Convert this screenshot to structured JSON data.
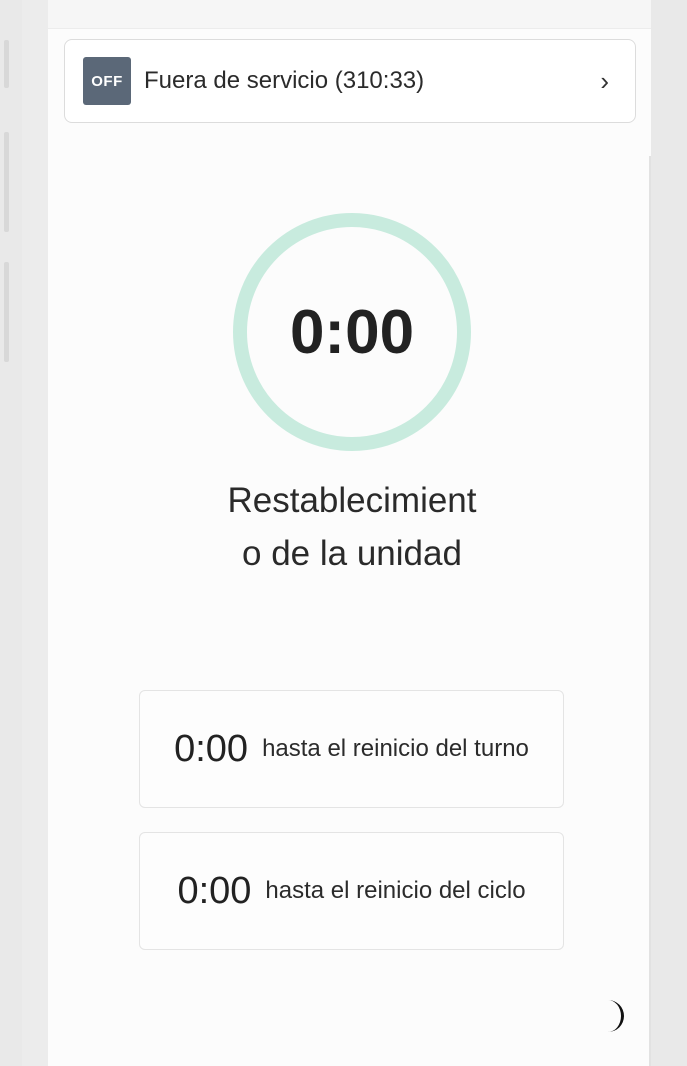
{
  "status": {
    "badge": "OFF",
    "label": "Fuera de servicio (310:33)",
    "chevron": "›"
  },
  "ring": {
    "time": "0:00",
    "caption": "Restablecimiento de la unidad",
    "color": "#c8ebde"
  },
  "timers": [
    {
      "time": "0:00",
      "label": "hasta el reinicio del turno"
    },
    {
      "time": "0:00",
      "label": "hasta el reinicio del ciclo"
    }
  ],
  "icons": {
    "status_chevron": "chevron-right-icon",
    "theme_toggle": "moon-icon"
  },
  "colors": {
    "badge_bg": "#5b6878",
    "ring": "#c8ebde",
    "text": "#222222"
  }
}
